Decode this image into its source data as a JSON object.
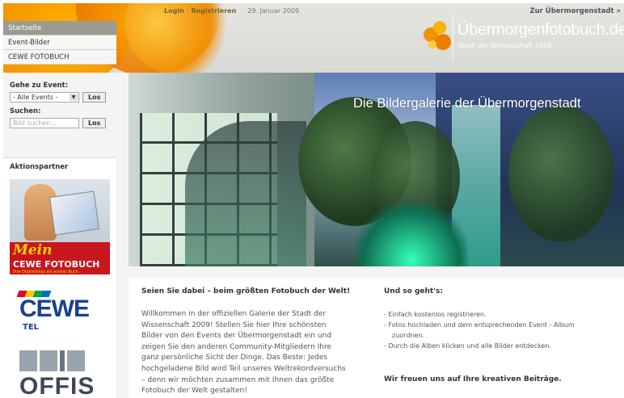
{
  "topbar": {
    "login": "Login",
    "separator": "|",
    "register": "Registrieren",
    "dash": "-",
    "date": "29. Januar 2009",
    "city_link": "Zur Übermorgenstadt »"
  },
  "logo": {
    "title": "Übermorgenfotobuch.de",
    "subtitle": "Stadt der Wissenschaft 2009"
  },
  "nav": {
    "items": [
      {
        "label": "Startseite",
        "active": true
      },
      {
        "label": "Event-Bilder",
        "active": false
      },
      {
        "label": "CEWE FOTOBUCH",
        "active": false
      }
    ]
  },
  "event_box": {
    "title": "Gehe zu Event:",
    "select_value": "- Alle Events -",
    "button": "Los"
  },
  "search_box": {
    "title": "Suchen:",
    "placeholder": "Bild suchen...",
    "button": "Los"
  },
  "partners": {
    "title": "Aktionspartner",
    "ad1": {
      "line1": "Mein",
      "line2": "CEWE FOTOBUCH",
      "line3": "Ihre Digitalfotos als echtes Buch."
    },
    "ad2": {
      "word": "CEWE",
      "sub": "TEL"
    },
    "ad3": {
      "word": "OFFIS"
    }
  },
  "hero": {
    "title": "Die Bildergalerie der Übermorgenstadt"
  },
  "content": {
    "left_heading": "Seien Sie dabei – beim größten Fotobuch der Welt!",
    "left_lines": [
      "Willkommen in der offiziellen Galerie der Stadt der",
      "Wissenschaft 2009! Stellen Sie hier Ihre schönsten",
      "Bilder von den Events der Übermorgenstadt ein und",
      "zeigen Sie den anderen Community-Mitgliedern Ihre",
      "ganz persönliche Sicht der Dinge. Das Beste: Jedes",
      "hochgeladene Bild wird Teil unseres Weltrekordversuchs",
      "– denn wir möchten zusammen mit Ihnen das größte",
      "Fotobuch der Welt gestalten!"
    ],
    "right_heading": "Und so geht's:",
    "steps": [
      {
        "text": "- Einfach kostenlos registrieren.",
        "indent": false
      },
      {
        "text": "- Fotos hochladen und dem entsprechenden Event - Album",
        "indent": false
      },
      {
        "text": "zuordnen.",
        "indent": true
      },
      {
        "text": "- Durch die Alben klicken und alle Bilder entdecken.",
        "indent": false
      }
    ],
    "closing": "Wir freuen uns auf Ihre kreativen Beiträge."
  },
  "colors": {
    "accent_orange": "#f39200",
    "nav_active": "#9b9b92",
    "cewe_blue": "#1b3f95",
    "cewe_red": "#c8161d"
  }
}
